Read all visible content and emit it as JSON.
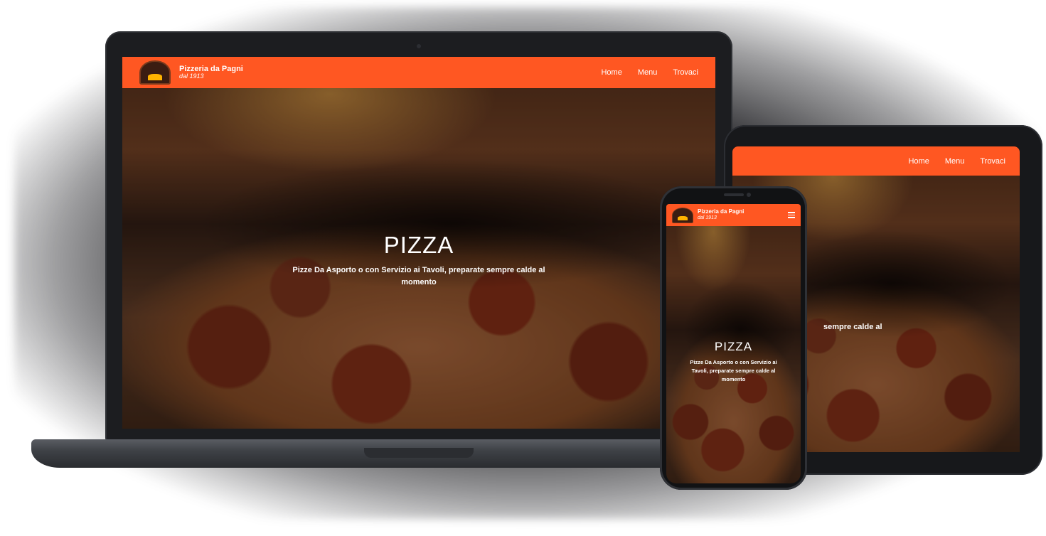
{
  "site": {
    "brand_name": "Pizzeria da Pagni",
    "since": "dal 1913",
    "nav": [
      {
        "label": "Home"
      },
      {
        "label": "Menu"
      },
      {
        "label": "Trovaci"
      }
    ],
    "hero_title": "PIZZA",
    "hero_subtitle": "Pizze Da Asporto o con Servizio ai Tavoli, preparate sempre calde al momento",
    "tablet_visible_fragment": "sempre calde al"
  },
  "colors": {
    "accent": "#ff5722",
    "device_frame": "#1c1d20"
  },
  "icons": {
    "logo": "pizza-oven-logo-icon",
    "mobile_menu": "hamburger-menu-icon"
  }
}
